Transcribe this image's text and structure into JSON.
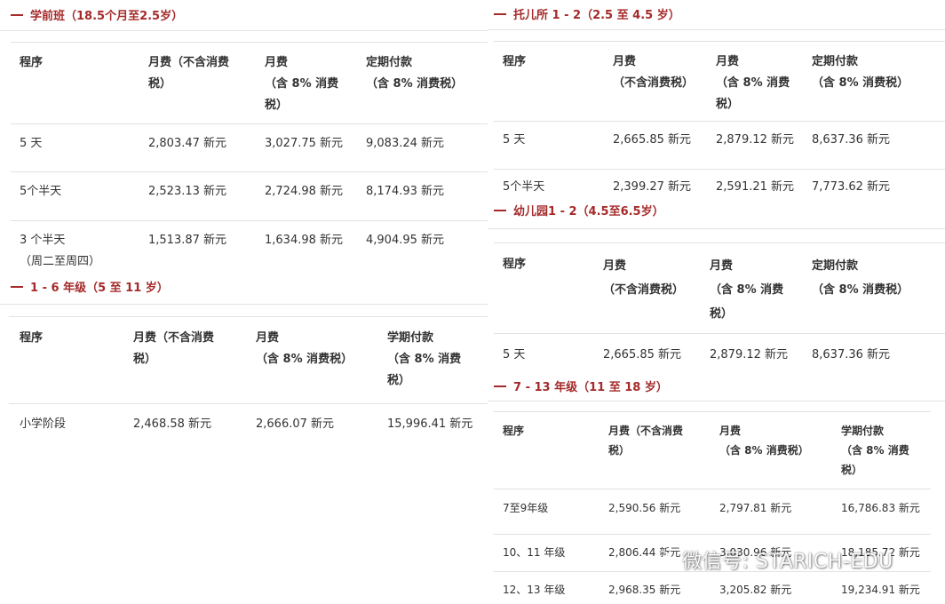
{
  "preschool": {
    "title": "学前班（18.5个月至2.5岁）",
    "headers": [
      "程序",
      "月费（不含消费\n税）",
      "月费\n （含 8% 消费\n税）",
      "定期付款\n （含 8% 消费税）"
    ],
    "rows": [
      [
        "5 天",
        "2,803.47 新元",
        "3,027.75 新元",
        "9,083.24 新元"
      ],
      [
        "5个半天",
        "2,523.13 新元",
        "2,724.98 新元",
        "8,174.93 新元"
      ],
      [
        "3 个半天\n （周二至周四）",
        "1,513.87 新元",
        "1,634.98 新元",
        "4,904.95 新元"
      ]
    ]
  },
  "nursery": {
    "title": "托儿所 1 - 2（2.5 至 4.5 岁）",
    "headers": [
      "程序",
      "月费\n （不含消费税）",
      "月费\n （含 8% 消费\n税）",
      "定期付款\n （含 8% 消费税）"
    ],
    "rows": [
      [
        "5 天",
        "2,665.85 新元",
        "2,879.12 新元",
        "8,637.36 新元"
      ],
      [
        "5个半天",
        "2,399.27 新元",
        "2,591.21 新元",
        "7,773.62 新元"
      ]
    ]
  },
  "kindergarten": {
    "title": "幼儿园1 - 2（4.5至6.5岁）",
    "headers": [
      "程序",
      "月费\n （不含消费税）",
      "月费\n （含 8% 消费\n税）",
      "定期付款\n （含 8% 消费税）"
    ],
    "rows": [
      [
        "5 天",
        "2,665.85 新元",
        "2,879.12 新元",
        "8,637.36 新元"
      ]
    ]
  },
  "primary": {
    "title": "1 - 6 年级（5 至 11 岁）",
    "headers": [
      "程序",
      "月费（不含消费\n税）",
      "月费\n （含 8% 消费税）",
      "学期付款\n （含 8% 消费\n税）"
    ],
    "rows": [
      [
        "小学阶段",
        "2,468.58 新元",
        "2,666.07 新元",
        "15,996.41 新元"
      ]
    ]
  },
  "secondary": {
    "title": "7 - 13 年级（11 至 18 岁）",
    "headers": [
      "程序",
      "月费（不含消费\n税）",
      "月费\n （含 8% 消费税）",
      "学期付款\n （含 8% 消费\n税）"
    ],
    "rows": [
      [
        "7至9年级",
        "2,590.56 新元",
        "2,797.81 新元",
        "16,786.83 新元"
      ],
      [
        "10、11 年级",
        "2,806.44 新元",
        "3,030.96 新元",
        "18,185.72 新元"
      ],
      [
        "12、13 年级",
        "2,968.35 新元",
        "3,205.82 新元",
        "19,234.91 新元"
      ]
    ]
  },
  "watermark": {
    "text": "微信号: STARICH-EDU",
    "icon": "wechat-icon"
  }
}
